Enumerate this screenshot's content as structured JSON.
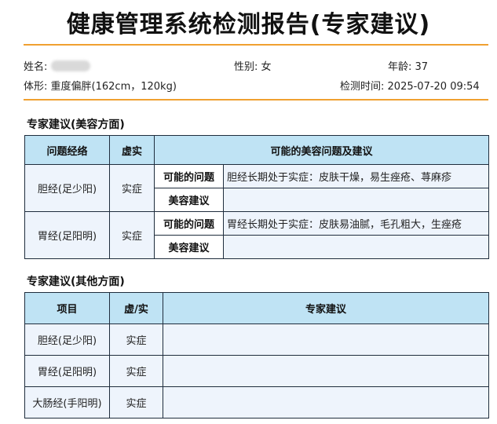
{
  "report": {
    "title": "健康管理系统检测报告(专家建议)"
  },
  "patient": {
    "name_label": "姓名:",
    "gender_label": "性别:",
    "gender_value": "女",
    "age_label": "年龄:",
    "age_value": "37",
    "body_label": "体形:",
    "body_value": "重度偏胖(162cm，120kg)",
    "time_label": "检测时间:",
    "time_value": "2025-07-20 09:54"
  },
  "beauty": {
    "section_title": "专家建议(美容方面)",
    "headers": [
      "问题经络",
      "虚实",
      "可能的美容问题及建议"
    ],
    "possible_label": "可能的问题",
    "advice_label": "美容建议",
    "rows": [
      {
        "meridian": "胆经(足少阳)",
        "type": "实症",
        "problem": "胆经长期处于实症：皮肤干燥，易生痤疮、荨麻疹",
        "advice": ""
      },
      {
        "meridian": "胃经(足阳明)",
        "type": "实症",
        "problem": "胃经长期处于实症：皮肤易油腻，毛孔粗大，生痤疮",
        "advice": ""
      }
    ]
  },
  "other": {
    "section_title": "专家建议(其他方面)",
    "headers": [
      "项目",
      "虚/实",
      "专家建议"
    ],
    "rows": [
      {
        "item": "胆经(足少阳)",
        "type": "实症",
        "advice": ""
      },
      {
        "item": "胃经(足阳明)",
        "type": "实症",
        "advice": ""
      },
      {
        "item": "大肠经(手阳明)",
        "type": "实症",
        "advice": ""
      }
    ]
  },
  "colors": {
    "accent_rule": "#f0a030",
    "header_bg": "#bfe3f4",
    "cell_bg": "#eef4fc",
    "border": "#1f2d3d"
  }
}
